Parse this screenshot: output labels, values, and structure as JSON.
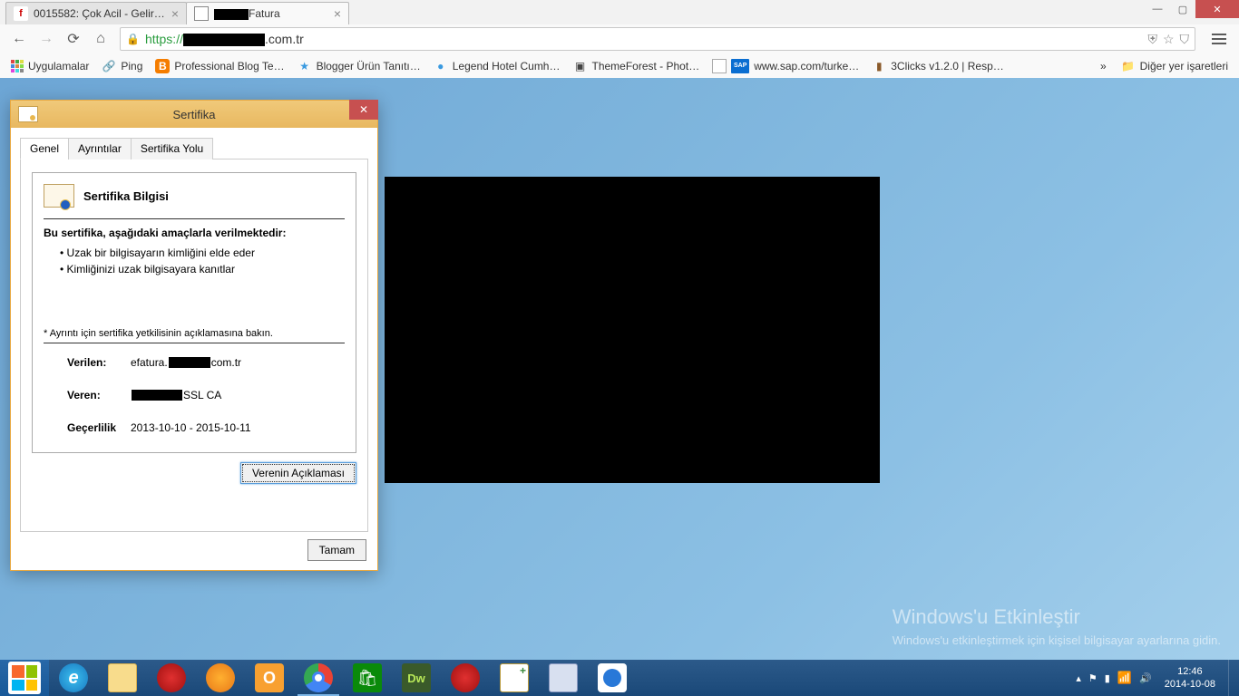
{
  "tabs": [
    {
      "title": "0015582: Çok Acil - Gelir İd",
      "active": false
    },
    {
      "prefix_redacted": true,
      "title": "Fatura",
      "active": true
    }
  ],
  "window_controls": {
    "min": "—",
    "max": "▢",
    "close": "✕"
  },
  "url": {
    "scheme": "https://",
    "domain_suffix": ".com.tr"
  },
  "bookmarks": {
    "apps": "Uygulamalar",
    "items": [
      "Ping",
      "Professional Blog Te…",
      "Blogger Ürün Tanıtı…",
      "Legend Hotel Cumh…",
      "ThemeForest - Phot…",
      "www.sap.com/turke…",
      "3Clicks v1.2.0 | Resp…"
    ],
    "more": "»",
    "other": "Diğer yer işaretleri"
  },
  "cert": {
    "title": "Sertifika",
    "tabs": [
      "Genel",
      "Ayrıntılar",
      "Sertifika Yolu"
    ],
    "info_title": "Sertifika Bilgisi",
    "purpose_heading": "Bu sertifika, aşağıdaki amaçlarla verilmektedir:",
    "purposes": [
      "Uzak bir bilgisayarın kimliğini elde eder",
      "Kimliğinizi uzak bilgisayara kanıtlar"
    ],
    "note": "* Ayrıntı için sertifika yetkilisinin açıklamasına bakın.",
    "issued_to_label": "Verilen:",
    "issued_to_prefix": "efatura.",
    "issued_to_suffix": "com.tr",
    "issuer_label": "Veren:",
    "issuer_suffix": "SSL CA",
    "validity_label": "Geçerlilik",
    "validity_value": "2013-10-10  -  2015-10-11",
    "issuer_statement_btn": "Verenin Açıklaması",
    "ok_btn": "Tamam"
  },
  "watermark": {
    "title": "Windows'u Etkinleştir",
    "sub": "Windows'u etkinleştirmek için kişisel bilgisayar ayarlarına gidin."
  },
  "tray": {
    "time": "12:46",
    "date": "2014-10-08"
  }
}
